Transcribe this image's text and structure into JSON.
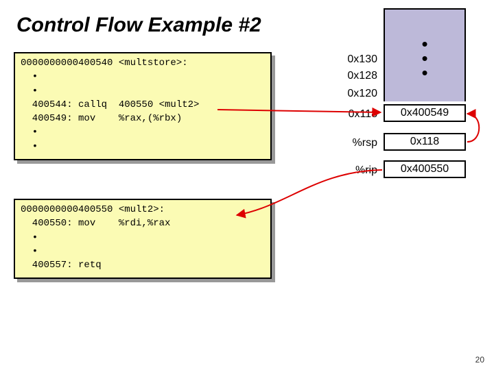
{
  "title": "Control Flow Example #2",
  "code1": {
    "header": "0000000000400540 <multstore>:",
    "lines": [
      "  •",
      "  •",
      "  400544: callq  400550 <mult2>",
      "  400549: mov    %rax,(%rbx)",
      "  •",
      "  •"
    ]
  },
  "code2": {
    "header": "0000000000400550 <mult2>:",
    "lines": [
      "  400550: mov    %rdi,%rax",
      "  •",
      "  •",
      "  400557: retq"
    ]
  },
  "addrs": {
    "a130": "0x130",
    "a128": "0x128",
    "a120": "0x120",
    "a118": "0x118"
  },
  "vals": {
    "v118": "0x400549"
  },
  "regs": {
    "rsp_label": "%rsp",
    "rsp_value": "0x118",
    "rip_label": "%rip",
    "rip_value": "0x400550"
  },
  "page": "20"
}
